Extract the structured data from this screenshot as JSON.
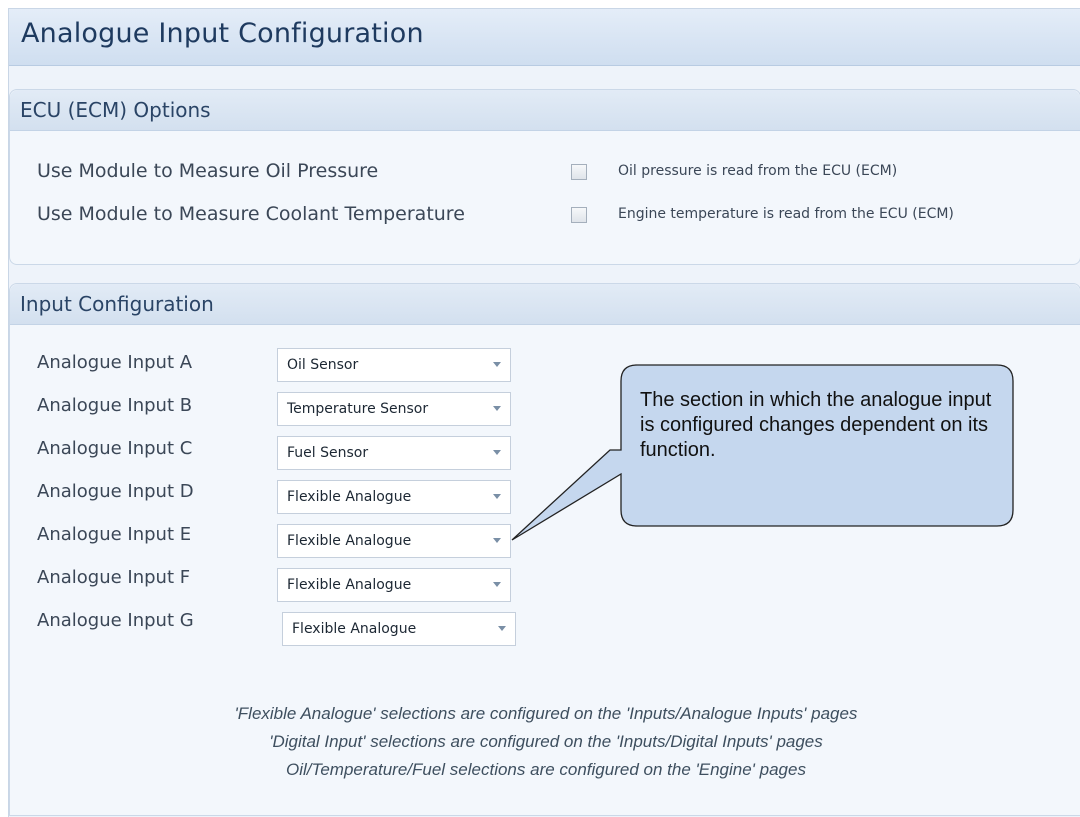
{
  "page": {
    "title": "Analogue Input Configuration"
  },
  "ecu_options": {
    "title": "ECU (ECM) Options",
    "options": [
      {
        "label": "Use Module to Measure Oil Pressure",
        "checked": false,
        "description": "Oil pressure is read from the ECU (ECM)"
      },
      {
        "label": "Use Module to Measure Coolant Temperature",
        "checked": false,
        "description": "Engine temperature is read from the ECU (ECM)"
      }
    ]
  },
  "input_configuration": {
    "title": "Input Configuration",
    "inputs": [
      {
        "label": "Analogue Input A",
        "value": "Oil Sensor"
      },
      {
        "label": "Analogue Input B",
        "value": "Temperature Sensor"
      },
      {
        "label": "Analogue Input C",
        "value": "Fuel Sensor"
      },
      {
        "label": "Analogue Input D",
        "value": "Flexible Analogue"
      },
      {
        "label": "Analogue Input E",
        "value": "Flexible Analogue"
      },
      {
        "label": "Analogue Input F",
        "value": "Flexible Analogue"
      },
      {
        "label": "Analogue Input G",
        "value": "Flexible Analogue"
      }
    ],
    "notes": [
      "'Flexible Analogue' selections are configured on the 'Inputs/Analogue Inputs' pages",
      "'Digital Input' selections are configured on the 'Inputs/Digital Inputs' pages",
      "Oil/Temperature/Fuel selections are configured on the 'Engine' pages"
    ]
  },
  "callout": {
    "text": "The section in which the analogue input is configured changes dependent on its function."
  },
  "colors": {
    "header_gradient_top": "#e4edf8",
    "header_gradient_bottom": "#cfdef0",
    "callout_fill": "#c5d7ee",
    "title_text": "#1e3a5f"
  }
}
